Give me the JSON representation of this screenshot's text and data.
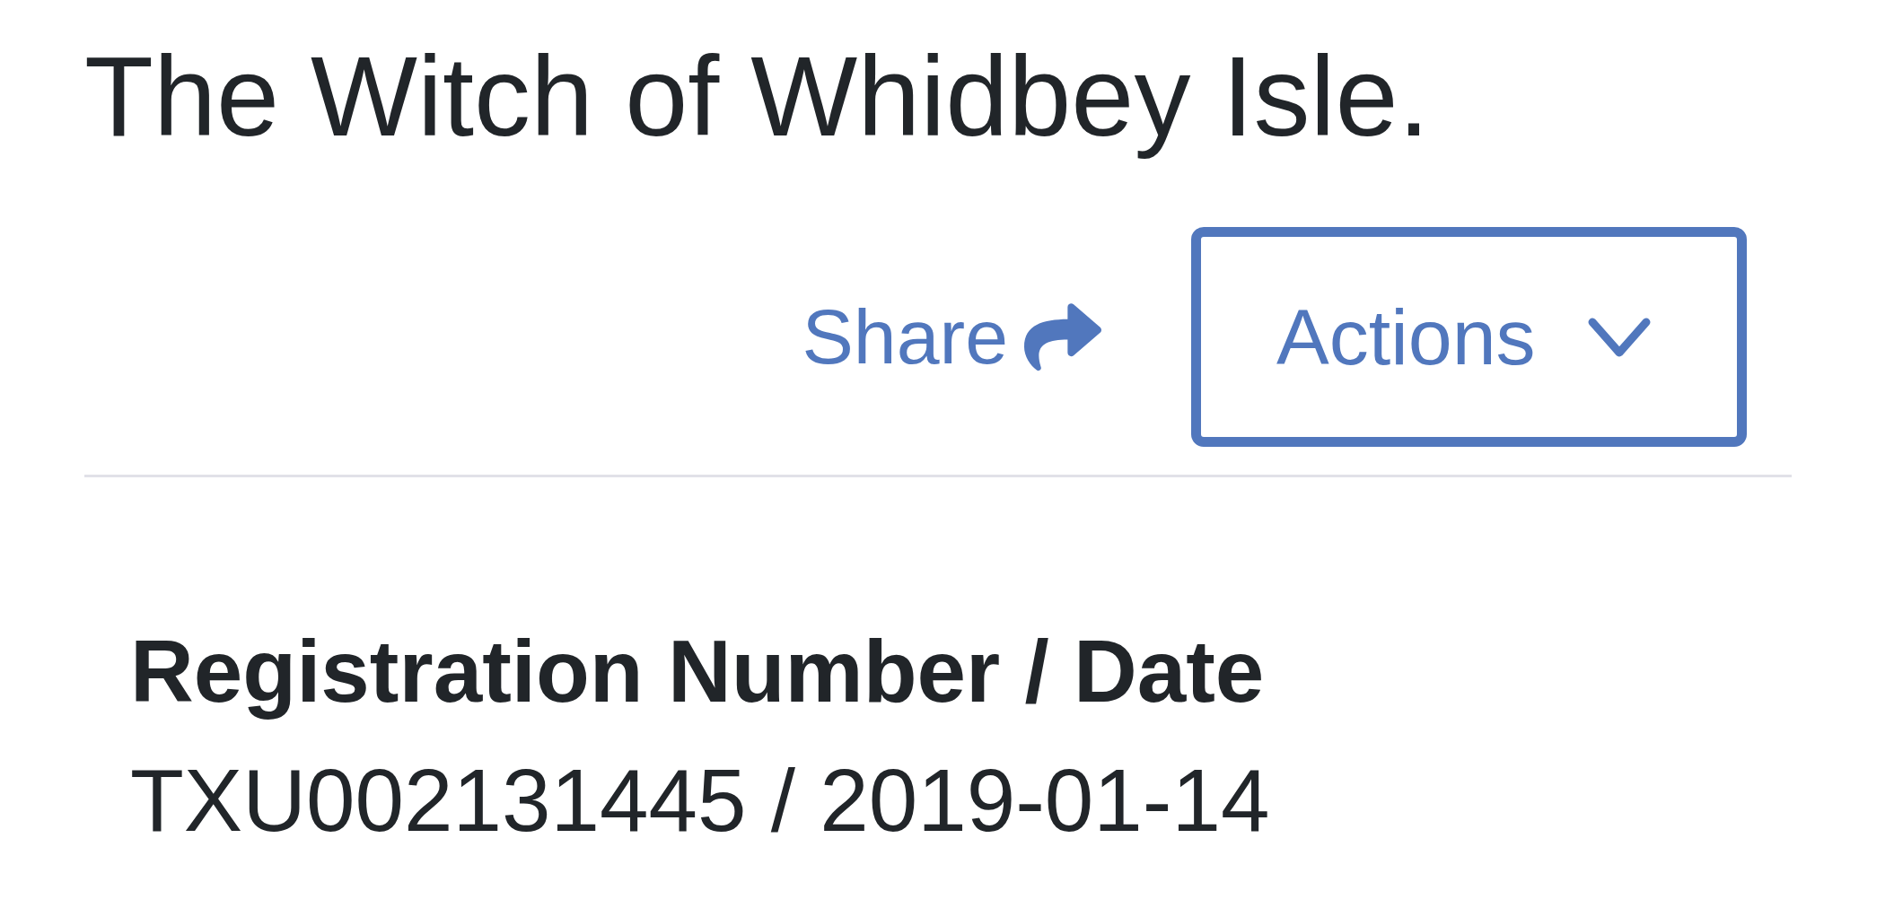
{
  "title": "The Witch of Whidbey Isle.",
  "toolbar": {
    "share": {
      "label": "Share"
    },
    "actions": {
      "label": "Actions"
    }
  },
  "details": [
    {
      "label": "Registration Number / Date",
      "value": "TXU002131445 / 2019-01-14"
    }
  ]
}
